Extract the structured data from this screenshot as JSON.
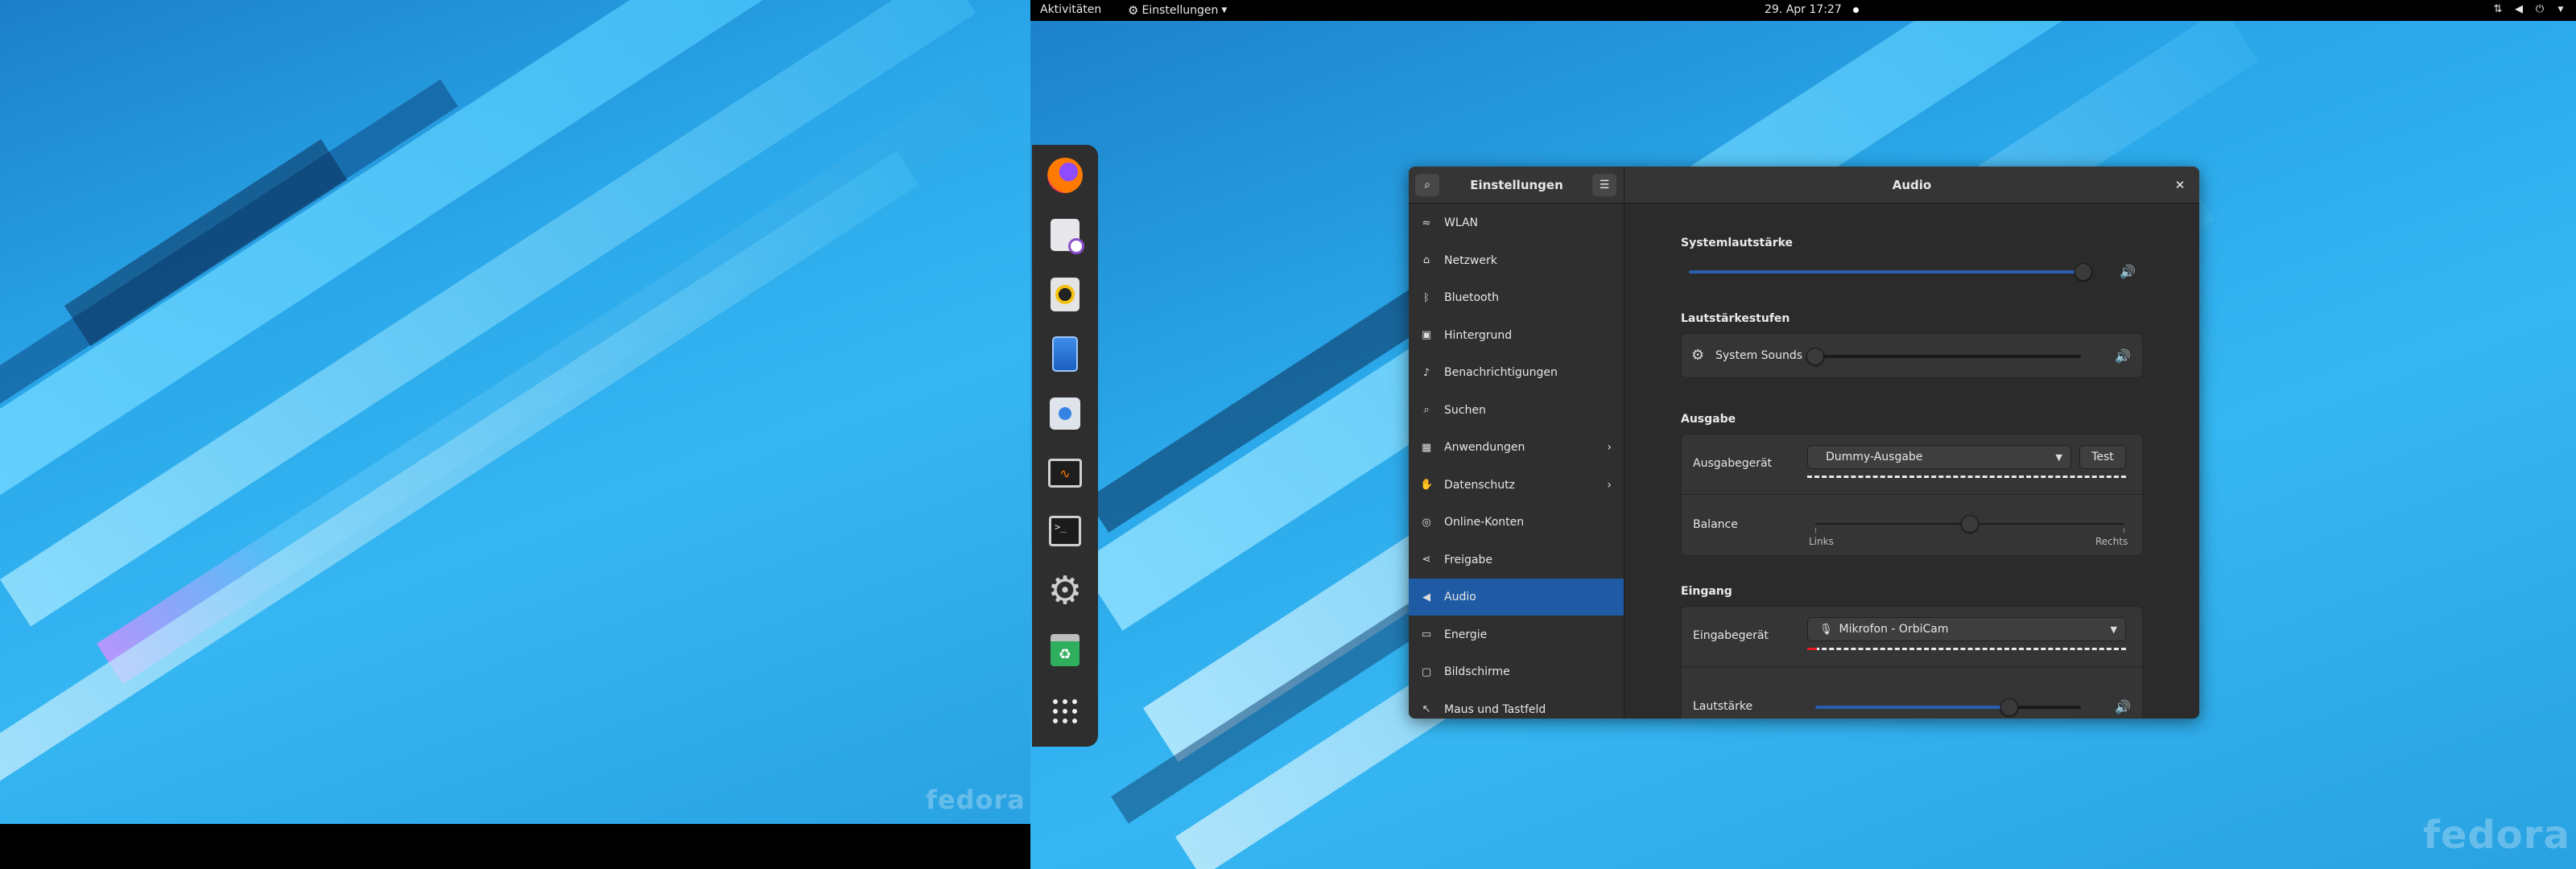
{
  "left_monitor": {
    "watermark": "fedora"
  },
  "right_monitor": {
    "watermark": "fedora"
  },
  "topbar": {
    "activities": "Aktivitäten",
    "app_menu": "Einstellungen",
    "clock": "29. Apr  17:27"
  },
  "dock": {
    "apps": [
      {
        "name": "Firefox",
        "icon": "firefox-icon"
      },
      {
        "name": "Kalender",
        "icon": "calendar-icon"
      },
      {
        "name": "Rhythmbox",
        "icon": "rhythmbox-icon"
      },
      {
        "name": "Dokumente",
        "icon": "documents-icon"
      },
      {
        "name": "Software",
        "icon": "software-icon"
      },
      {
        "name": "Systemüberwachung",
        "icon": "system-monitor-icon"
      },
      {
        "name": "Terminal",
        "icon": "terminal-icon"
      },
      {
        "name": "Einstellungen",
        "icon": "settings-gear-icon"
      },
      {
        "name": "Papierkorb",
        "icon": "trash-icon"
      },
      {
        "name": "Anwendungen anzeigen",
        "icon": "app-grid-icon"
      }
    ],
    "terminal_glyph": ">_"
  },
  "window": {
    "sidebar_title": "Einstellungen",
    "main_title": "Audio",
    "sidebar_items": [
      {
        "label": "WLAN",
        "icon": "wifi-icon",
        "glyph": "≈"
      },
      {
        "label": "Netzwerk",
        "icon": "network-icon",
        "glyph": "⌂"
      },
      {
        "label": "Bluetooth",
        "icon": "bluetooth-icon",
        "glyph": "ᛒ"
      },
      {
        "label": "Hintergrund",
        "icon": "background-icon",
        "glyph": "▣"
      },
      {
        "label": "Benachrichtigungen",
        "icon": "bell-icon",
        "glyph": "♪"
      },
      {
        "label": "Suchen",
        "icon": "search-icon",
        "glyph": "⌕"
      },
      {
        "label": "Anwendungen",
        "icon": "applications-icon",
        "glyph": "▦",
        "has_chevron": true
      },
      {
        "label": "Datenschutz",
        "icon": "privacy-icon",
        "glyph": "✋",
        "has_chevron": true
      },
      {
        "label": "Online-Konten",
        "icon": "online-accounts-icon",
        "glyph": "◎"
      },
      {
        "label": "Freigabe",
        "icon": "sharing-icon",
        "glyph": "⋖"
      },
      {
        "label": "Audio",
        "icon": "audio-icon",
        "glyph": "◀",
        "active": true
      },
      {
        "label": "Energie",
        "icon": "power-icon",
        "glyph": "▭"
      },
      {
        "label": "Bildschirme",
        "icon": "display-icon",
        "glyph": "▢"
      },
      {
        "label": "Maus und Tastfeld",
        "icon": "mouse-icon",
        "glyph": "↖"
      }
    ],
    "sections": {
      "system_volume": {
        "heading": "Systemlautstärke",
        "level": 0.98
      },
      "volume_levels": {
        "heading": "Lautstärkestufen",
        "item_label": "System Sounds",
        "level": 0.0
      },
      "output": {
        "heading": "Ausgabe",
        "device_label": "Ausgabegerät",
        "device_value": "Dummy-Ausgabe",
        "test_label": "Test",
        "balance_label": "Balance",
        "balance_left": "Links",
        "balance_right": "Rechts",
        "balance_value": 0.5
      },
      "input": {
        "heading": "Eingang",
        "device_label": "Eingabegerät",
        "device_value": "Mikrofon - OrbiCam",
        "volume_label": "Lautstärke",
        "level": 0.73
      }
    }
  },
  "colors": {
    "accent": "#1f5aa5",
    "slider_fill": "#2a5fb0",
    "mic_level": "#e01b24"
  }
}
